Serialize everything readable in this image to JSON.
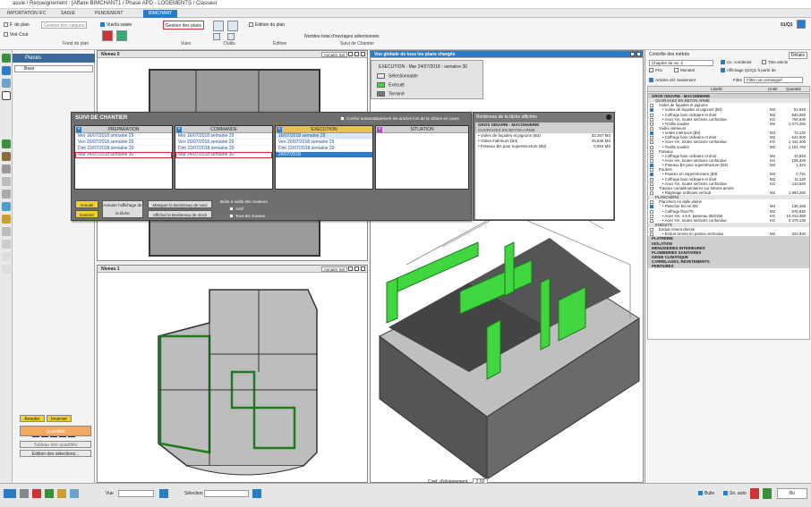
{
  "window": {
    "title": "assie / Renseignement : [Affaire BIMCHANT1 / Phase APD - LOGEMENTS / Classeur"
  },
  "tabs": [
    {
      "label": "IMPORTATION IFC",
      "active": false
    },
    {
      "label": "SAISIE",
      "active": false
    },
    {
      "label": "PENDEMENT",
      "active": false
    },
    {
      "label": "BIMCHANT",
      "active": true
    }
  ],
  "ribbon": {
    "fond_de_plan": {
      "check1": "F. de plan",
      "check2": "Voir Cout",
      "btn": "Gestion des calques",
      "group": "Fond de plan"
    },
    "vues": {
      "check": "Vue/la saisie",
      "btn": "Gestion des plans",
      "group": "Vues"
    },
    "outils": {
      "group": "Outils"
    },
    "edition": {
      "btn": "Edition du plan",
      "group": "Edition"
    },
    "suivi": {
      "label": "Nombre total d'ouvrages sélectionnés",
      "group": "Suivi de Chantier"
    },
    "version": "01/Q1"
  },
  "left_panel": {
    "title": "Pieces",
    "combo": "Base",
    "ybtn1": "Annuler",
    "ybtn2": "Inverser",
    "orange": "Quantités",
    "btn1": "Tableau des quantités",
    "btn2": "Edition des sélections..."
  },
  "views": {
    "level0": {
      "title": "Niveau 0",
      "annul": "Annuler Sel"
    },
    "level1": {
      "title": "Niveau 1",
      "annul": "Annuler Sel"
    },
    "global": {
      "title": "Vue globale de tous les plans chargés"
    }
  },
  "legend": {
    "title": "EXECUTION - Mar 24/07/2018 - semaine 30",
    "items": [
      {
        "label": "Sélectionnable",
        "color": "#e8e8e8"
      },
      {
        "label": "Exécuté",
        "color": "#3fd63f"
      },
      {
        "label": "Terminé",
        "color": "#777777"
      }
    ]
  },
  "suivi": {
    "title": "SUIVI DE CHANTIER",
    "cocher": "Cocher automatiquement les articles lors de la clôture en cours",
    "columns": [
      {
        "header": "PREPARATION",
        "rows": [
          "Mer 16/07/2018  semaine 29",
          "Ven 20/07/2018  semaine 29",
          "Dim 22/07/2018  semaine 29",
          "Mar 24/07/2018  semaine 30"
        ]
      },
      {
        "header": "COMMANDE",
        "rows": [
          "Mer 16/07/2018  semaine 29",
          "Ven 20/07/2018  semaine 29",
          "Dim 22/07/2018  semaine 29",
          "Mar 24/07/2018  semaine 30"
        ]
      },
      {
        "header": "EXECUTION",
        "rows": [
          "16/07/2018  semaine 29",
          "Ven 20/07/2018  semaine 29",
          "Dim 22/07/2018  semaine 29",
          "24/07/2018"
        ]
      },
      {
        "header": "SITUATION",
        "rows": []
      }
    ],
    "btn_annuler": "Annuler",
    "btn_inverser": "Inverser",
    "btn_annuler_aff": "Annuler l'affichage de la tâche",
    "btn_masquer": "Masquer le Bordereau de suivi",
    "btn_afficher": "Afficher le Bordereau de stock",
    "boite_label": "Boîte à outils des couleurs",
    "opt_actif": "Actif",
    "opt_tous": "Tous les niveaux"
  },
  "bordereau": {
    "title": "Bordereau de la tâche affichée",
    "lines": [
      {
        "text": "GROS OEUVRE - MACONNERIE",
        "value": "",
        "kind": "sec"
      },
      {
        "text": "OUVRAGES EN BETON ARME",
        "value": "",
        "kind": "sec"
      },
      {
        "text": "• Voiles de façades et pignons (B3)",
        "value": "32,307  M3",
        "kind": "item"
      },
      {
        "text": "• Voiles intérieurs (B3)",
        "value": "15,845  M3",
        "kind": "item"
      },
      {
        "text": "• Poteaux BA pour superstructure (B3)",
        "value": "0,804  M3",
        "kind": "item"
      }
    ]
  },
  "coef": {
    "label": "Coef. d'éloignement",
    "value": "2,50"
  },
  "right_panel": {
    "controle": "Contrôle des métrés",
    "chapitre": "Chapitre de niv. 2",
    "ux": "Ux. condensé",
    "titre_article": "Titre article",
    "prix": "Prix",
    "montant": "Montant",
    "affichage": "Affichage Q1/Q1 à partir de",
    "articles_sel": "Articles sél. seulement",
    "filtre_label": "Filtre",
    "filtre": "Filtre non renseigné",
    "col_libelle": "Libellé",
    "col_unite": "Unité",
    "col_quantite": "Quantité",
    "details": "Détails"
  },
  "tree": [
    {
      "t": "GROS OEUVRE - MACONNERIE",
      "u": "",
      "q": "",
      "l": 0,
      "c": false
    },
    {
      "t": "OUVRAGES EN BETON ARME",
      "u": "",
      "q": "",
      "l": 1,
      "c": false
    },
    {
      "t": "Voiles de façades et pignons",
      "u": "",
      "q": "",
      "l": 2,
      "c": false
    },
    {
      "t": "• Voiles de façades et pignons (B3)",
      "u": "M3",
      "q": "52,946",
      "l": 3,
      "c": true
    },
    {
      "t": "• Coffrage bois ordinaire et droit",
      "u": "M2",
      "q": "840,260",
      "l": 3,
      "c": false
    },
    {
      "t": "• Acier HA, toutes sections confondue",
      "u": "KG",
      "q": "769,638",
      "l": 3,
      "c": false
    },
    {
      "t": "• Treillis soudés",
      "u": "M2",
      "q": "1 073,250",
      "l": 3,
      "c": false
    },
    {
      "t": "Voiles intérieurs",
      "u": "",
      "q": "",
      "l": 2,
      "c": false
    },
    {
      "t": "• Voiles intérieurs (B3)",
      "u": "M3",
      "q": "72,120",
      "l": 3,
      "c": true
    },
    {
      "t": "• Coffrage bois ordinaire et droit",
      "u": "M2",
      "q": "642,600",
      "l": 3,
      "c": false
    },
    {
      "t": "• Acier HA, toutes sections confondue",
      "u": "KG",
      "q": "1 442,400",
      "l": 3,
      "c": false
    },
    {
      "t": "• Treillis soudés",
      "u": "M2",
      "q": "1 151,760",
      "l": 3,
      "c": false
    },
    {
      "t": "Poteaux",
      "u": "",
      "q": "",
      "l": 2,
      "c": false
    },
    {
      "t": "• Coffrage bois ordinaire et droit",
      "u": "M2",
      "q": "10,940",
      "l": 3,
      "c": false
    },
    {
      "t": "• Acier HA, toutes sections confondue",
      "u": "KG",
      "q": "105,329",
      "l": 3,
      "c": false
    },
    {
      "t": "• Poteaux BA pour superstructure (B3)",
      "u": "M3",
      "q": "1,324",
      "l": 3,
      "c": true
    },
    {
      "t": "Poutres",
      "u": "",
      "q": "",
      "l": 2,
      "c": false
    },
    {
      "t": "• Poutres en superstructure (B3)",
      "u": "M3",
      "q": "0,741",
      "l": 3,
      "c": true
    },
    {
      "t": "• Coffrage bois ordinaire et droit",
      "u": "M2",
      "q": "11,120",
      "l": 3,
      "c": false
    },
    {
      "t": "• Acier HA, toutes sections confondue",
      "u": "KG",
      "q": "110,640",
      "l": 3,
      "c": false
    },
    {
      "t": "Travaux complémentaires sur bétons armés",
      "u": "",
      "q": "",
      "l": 2,
      "c": false
    },
    {
      "t": "• Ragréage ordinaire vertical",
      "u": "M2",
      "q": "1 894,260",
      "l": 3,
      "c": false
    },
    {
      "t": "PLANCHERS",
      "u": "",
      "q": "",
      "l": 1,
      "c": false
    },
    {
      "t": "Planchers en dalle pleine",
      "u": "",
      "q": "",
      "l": 2,
      "c": false
    },
    {
      "t": "• Plancher BA en M3",
      "u": "M3",
      "q": "135,166",
      "l": 3,
      "c": true
    },
    {
      "t": "• Coffrage fibre/75",
      "u": "M2",
      "q": "675,830",
      "l": 3,
      "c": false
    },
    {
      "t": "• Acier HA, 4.5.0, panneau 250/150",
      "u": "KG",
      "q": "10 013,380",
      "l": 3,
      "c": false
    },
    {
      "t": "• Acier HA, toutes sections confondue",
      "u": "KG",
      "q": "3 379,135",
      "l": 3,
      "c": false
    },
    {
      "t": "ENDUITS",
      "u": "",
      "q": "",
      "l": 1,
      "c": false
    },
    {
      "t": "Enduit ciment dressé",
      "u": "",
      "q": "",
      "l": 2,
      "c": false
    },
    {
      "t": "• Enduit ciment en parties verticales",
      "u": "M2",
      "q": "323,930",
      "l": 3,
      "c": false
    },
    {
      "t": "PLATRERIE",
      "u": "",
      "q": "",
      "l": 0,
      "c": false
    },
    {
      "t": "ISOLATION",
      "u": "",
      "q": "",
      "l": 0,
      "c": false
    },
    {
      "t": "MENUISERIES INTERIEURES",
      "u": "",
      "q": "",
      "l": 0,
      "c": false
    },
    {
      "t": "PLOMBERIES SANITAIRES",
      "u": "",
      "q": "",
      "l": 0,
      "c": false
    },
    {
      "t": "GENIE CLIMATIQUE",
      "u": "",
      "q": "",
      "l": 0,
      "c": false
    },
    {
      "t": "CARRELAGES, REVETEMENTS",
      "u": "",
      "q": "",
      "l": 0,
      "c": false
    },
    {
      "t": "PEINTURES",
      "u": "",
      "q": "",
      "l": 0,
      "c": false
    }
  ],
  "statusbar": {
    "vue": "Vue",
    "selection": "Sélection",
    "bulle": "Bulle",
    "sn_auto": "Sn. auto",
    "ok": "Bo"
  }
}
